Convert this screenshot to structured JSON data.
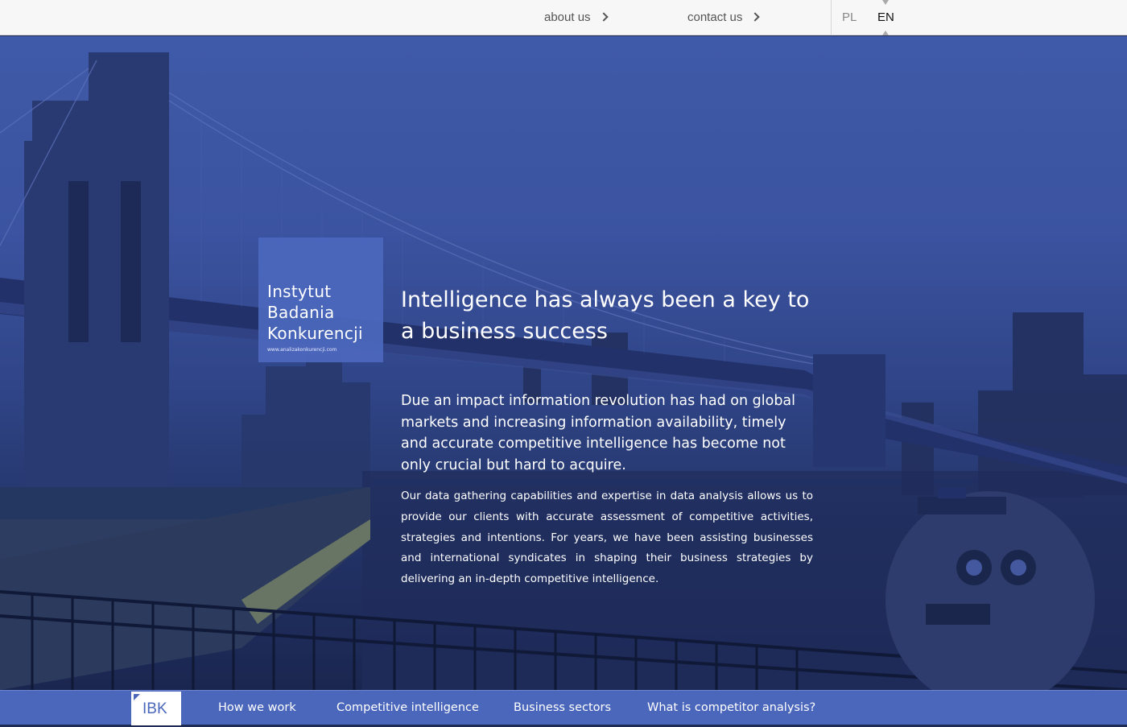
{
  "top_nav": {
    "about_label": "about us",
    "contact_label": "contact us"
  },
  "languages": {
    "pl": "PL",
    "en": "EN",
    "active": "EN"
  },
  "logo": {
    "line1": "Instytut",
    "line2": "Badania",
    "line3": "Konkurencji",
    "url": "www.analizakonkurencji.com"
  },
  "hero": {
    "headline": "Intelligence has always been a key to a business success",
    "lead": "Due an impact information revolution has had on global markets and increasing information availability, timely and accurate competitive intelligence has become not only crucial but hard to acquire.",
    "body": "Our data gathering capabilities and expertise in data analysis allows us to provide our clients with accurate assessment of competitive activities, strategies and intentions. For years, we have been assisting businesses and international syndicates in shaping their business strategies by delivering an in-depth competitive intelligence."
  },
  "bottom_nav": {
    "home_label": "IBK",
    "items": [
      "How we work",
      "Competitive intelligence",
      "Business sectors",
      "What is competitor analysis?"
    ]
  },
  "colors": {
    "accent": "#4b67bb",
    "topbar_bg": "#f7f7f7",
    "hero_tint": "#3f5aa8"
  },
  "icons": {
    "nav_arrow": "chevron-right-icon"
  }
}
